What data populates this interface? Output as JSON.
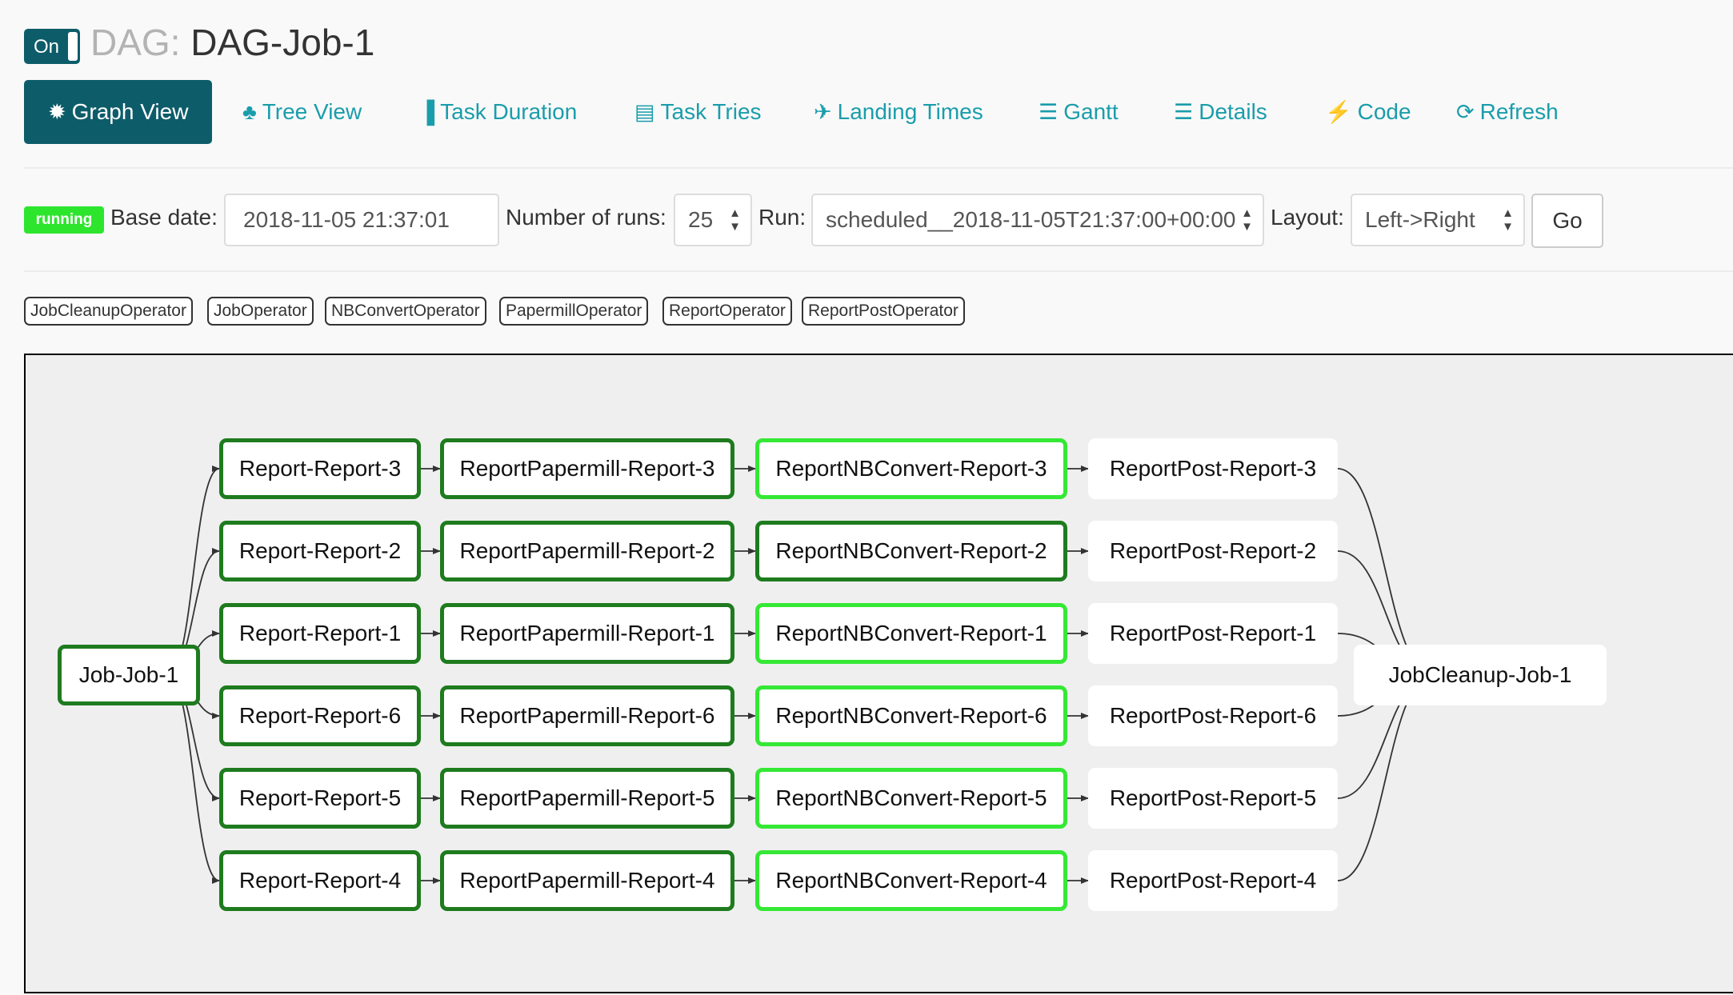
{
  "header": {
    "toggle_label": "On",
    "title_prefix": "DAG:",
    "dag_name": "DAG-Job-1"
  },
  "nav": [
    {
      "id": "graph-view",
      "label": "Graph View",
      "icon": "asterisk-icon",
      "glyph": "✹",
      "active": true
    },
    {
      "id": "tree-view",
      "label": "Tree View",
      "icon": "tree-icon",
      "glyph": "♣",
      "active": false
    },
    {
      "id": "task-duration",
      "label": "Task Duration",
      "icon": "bar-chart-icon",
      "glyph": "▐",
      "active": false
    },
    {
      "id": "task-tries",
      "label": "Task Tries",
      "icon": "files-icon",
      "glyph": "▤",
      "active": false
    },
    {
      "id": "landing-times",
      "label": "Landing Times",
      "icon": "plane-icon",
      "glyph": "✈",
      "active": false
    },
    {
      "id": "gantt",
      "label": "Gantt",
      "icon": "gantt-icon",
      "glyph": "☰",
      "active": false
    },
    {
      "id": "details",
      "label": "Details",
      "icon": "list-icon",
      "glyph": "☰",
      "active": false
    },
    {
      "id": "code",
      "label": "Code",
      "icon": "flash-icon",
      "glyph": "⚡",
      "active": false
    },
    {
      "id": "refresh",
      "label": "Refresh",
      "icon": "refresh-icon",
      "glyph": "⟳",
      "active": false
    }
  ],
  "controls": {
    "state_badge": "running",
    "base_date_label": "Base date:",
    "base_date_value": "2018-11-05 21:37:01",
    "num_runs_label": "Number of runs:",
    "num_runs_value": "25",
    "run_label": "Run:",
    "run_value": "scheduled__2018-11-05T21:37:00+00:00",
    "layout_label": "Layout:",
    "layout_value": "Left->Right",
    "go_label": "Go"
  },
  "operators": [
    "JobCleanupOperator",
    "JobOperator",
    "NBConvertOperator",
    "PapermillOperator",
    "ReportOperator",
    "ReportPostOperator"
  ],
  "colors": {
    "primary": "#0d5c6a",
    "link": "#1a9dab",
    "running": "#2ee52e",
    "success": "#1e7b1e",
    "running_border": "#35e835",
    "queued_border": "#ffffff"
  },
  "graph": {
    "source": {
      "label": "Job-Job-1",
      "state": "success"
    },
    "sink": {
      "label": "JobCleanup-Job-1",
      "state": "none"
    },
    "rows": [
      {
        "report": "Report-Report-3",
        "papermill": "ReportPapermill-Report-3",
        "nbconvert": "ReportNBConvert-Report-3",
        "nbconvert_state": "running",
        "post": "ReportPost-Report-3"
      },
      {
        "report": "Report-Report-2",
        "papermill": "ReportPapermill-Report-2",
        "nbconvert": "ReportNBConvert-Report-2",
        "nbconvert_state": "success",
        "post": "ReportPost-Report-2"
      },
      {
        "report": "Report-Report-1",
        "papermill": "ReportPapermill-Report-1",
        "nbconvert": "ReportNBConvert-Report-1",
        "nbconvert_state": "running",
        "post": "ReportPost-Report-1"
      },
      {
        "report": "Report-Report-6",
        "papermill": "ReportPapermill-Report-6",
        "nbconvert": "ReportNBConvert-Report-6",
        "nbconvert_state": "running",
        "post": "ReportPost-Report-6"
      },
      {
        "report": "Report-Report-5",
        "papermill": "ReportPapermill-Report-5",
        "nbconvert": "ReportNBConvert-Report-5",
        "nbconvert_state": "running",
        "post": "ReportPost-Report-5"
      },
      {
        "report": "Report-Report-4",
        "papermill": "ReportPapermill-Report-4",
        "nbconvert": "ReportNBConvert-Report-4",
        "nbconvert_state": "running",
        "post": "ReportPost-Report-4"
      }
    ]
  }
}
